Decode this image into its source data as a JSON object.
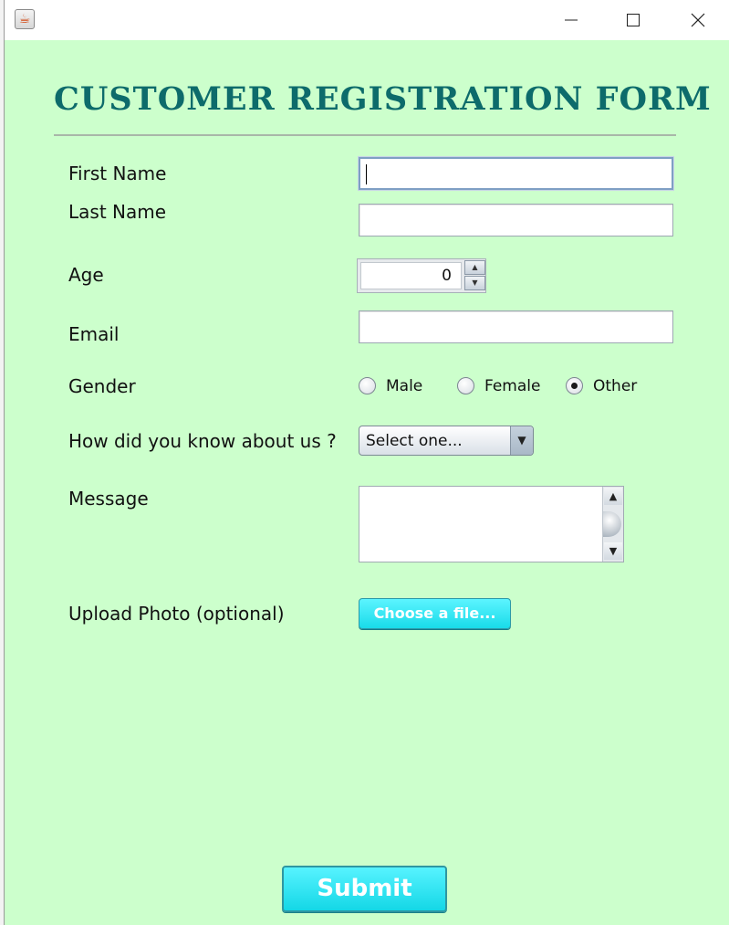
{
  "window": {
    "app_icon": "java-cup-icon",
    "controls": [
      "minimize-icon",
      "maximize-icon",
      "close-icon"
    ]
  },
  "form": {
    "title": "CUSTOMER REGISTRATION FORM",
    "labels": {
      "first_name": "First Name",
      "last_name": "Last Name",
      "age": "Age",
      "email": "Email",
      "gender": "Gender",
      "source": "How did you know about us ?",
      "message": "Message",
      "photo": "Upload Photo (optional)"
    },
    "fields": {
      "first_name": "",
      "last_name": "",
      "email": "",
      "message": ""
    },
    "age": "0",
    "gender_options": [
      "Male",
      "Female",
      "Other"
    ],
    "gender_selected": "Other",
    "source_selected": "Select one...",
    "upload_button": "Choose a file...",
    "submit": "Submit"
  },
  "colors": {
    "background": "#ccffcc",
    "title": "#0d6b6b",
    "button": "#19dbe9"
  }
}
